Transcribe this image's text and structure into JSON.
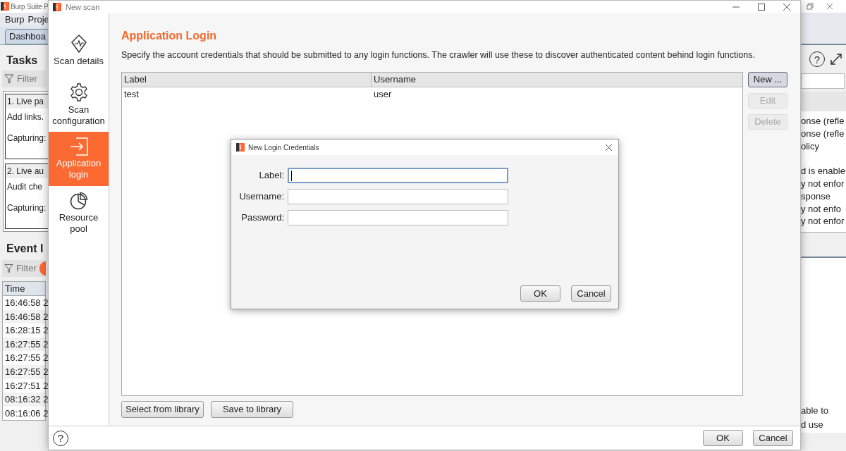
{
  "background_window": {
    "title": "Burp Suite P",
    "menu": [
      "Burp",
      "Proje"
    ],
    "tab": "Dashboa",
    "help_glyph": "?",
    "tasks_heading": "Tasks",
    "tasks_filter": "Filter",
    "tasks": [
      {
        "title": "1. Live pa",
        "lines": [
          "Add links.",
          "Capturing:"
        ]
      },
      {
        "title": "2. Live au",
        "lines": [
          "Audit che",
          "Capturing:"
        ]
      }
    ],
    "event_log_heading": "Event l",
    "event_filter": "Filter",
    "event_filter_toggle": {
      "on": true
    },
    "time_column": "Time",
    "times": [
      "16:46:58 2",
      "16:46:58 2",
      "16:28:15 2",
      "16:27:55 2",
      "16:27:55 2",
      "16:27:55 2",
      "16:27:51 2",
      "08:16:32 2",
      "08:16:06 2"
    ],
    "issue_fragments": [
      "onse (refle",
      "onse (refle",
      "olicy",
      "d is enable",
      "y not enfor",
      "sponse",
      "y not enfo",
      "y not enfor"
    ],
    "detail_fragments": [
      "able to",
      "d use"
    ]
  },
  "dialog": {
    "title": "New scan",
    "sidebar": [
      {
        "label": "Scan details",
        "selected": false
      },
      {
        "label": "Scan configuration",
        "selected": false
      },
      {
        "label": "Application login",
        "selected": true
      },
      {
        "label": "Resource pool",
        "selected": false
      }
    ],
    "heading": "Application Login",
    "description": "Specify the account credentials that should be submitted to any login functions. The crawler will use these to discover authenticated content behind login functions.",
    "table": {
      "columns": [
        "Label",
        "Username"
      ],
      "rows": [
        [
          "test",
          "user"
        ]
      ]
    },
    "side_buttons": [
      {
        "label": "New ...",
        "disabled": false
      },
      {
        "label": "Edit",
        "disabled": true
      },
      {
        "label": "Delete",
        "disabled": true
      }
    ],
    "library_buttons": [
      "Select from library",
      "Save to library"
    ],
    "help_glyph": "?",
    "footer_buttons": [
      "OK",
      "Cancel"
    ]
  },
  "modal": {
    "title": "New Login Credentials",
    "fields": [
      {
        "label": "Label:",
        "focused": true
      },
      {
        "label": "Username:",
        "focused": false
      },
      {
        "label": "Password:",
        "focused": false
      }
    ],
    "buttons": [
      "OK",
      "Cancel"
    ]
  }
}
